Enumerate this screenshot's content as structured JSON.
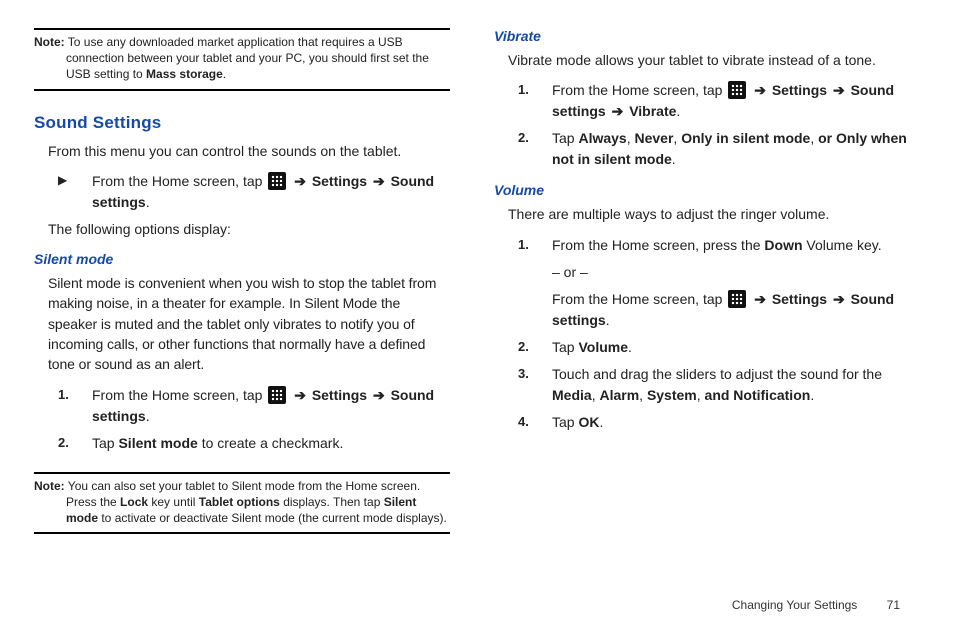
{
  "left": {
    "note1_label": "Note:",
    "note1_text": " To use any downloaded market application that requires a USB connection between your tablet and your PC, you should first set the USB setting to ",
    "note1_bold": "Mass storage",
    "note1_tail": ".",
    "h2": "Sound Settings",
    "intro": "From this menu you can control the sounds on the tablet.",
    "bullet_marker": "▶",
    "bullet_pre": "From the Home screen, tap ",
    "arrow": "➔",
    "settings": "Settings",
    "sound_settings": "Sound settings",
    "period": ".",
    "options": "The following options display:",
    "silent_h": "Silent mode",
    "silent_body": "Silent mode is convenient when you wish to stop the tablet from making noise, in a theater for example. In Silent Mode the speaker is muted and the tablet only vibrates to notify you of incoming calls, or other functions that normally have a defined tone or sound as an alert.",
    "s1_m": "1.",
    "s1_pre": "From the Home screen, tap ",
    "s2_m": "2.",
    "s2_pre": "Tap ",
    "s2_bold": "Silent mode",
    "s2_tail": " to create a checkmark.",
    "note2_label": "Note:",
    "note2_a": " You can also set your tablet to Silent mode from the Home screen. Press the ",
    "note2_lock": "Lock",
    "note2_b": " key until ",
    "note2_tabopt": "Tablet options",
    "note2_c": " displays. Then tap ",
    "note2_silent": "Silent mode",
    "note2_d": " to activate or deactivate Silent mode (the current mode displays)."
  },
  "right": {
    "vibrate_h": "Vibrate",
    "vibrate_body": "Vibrate mode allows your tablet to vibrate instead of a tone.",
    "v1_m": "1.",
    "v1_pre": "From the Home screen, tap ",
    "arrow": "➔",
    "settings": "Settings",
    "sound_settings": "Sound settings",
    "vibrate": "Vibrate",
    "period": ".",
    "v2_m": "2.",
    "v2_pre": "Tap ",
    "v2_always": "Always",
    "v2_c1": ", ",
    "v2_never": "Never",
    "v2_c2": ", ",
    "v2_onlysilent": "Only in silent mode",
    "v2_c3": ", ",
    "v2_oronly": "or Only when not in silent mode",
    "volume_h": "Volume",
    "volume_body": "There are multiple ways to adjust the ringer volume.",
    "u1_m": "1.",
    "u1_a": "From the Home screen, press the ",
    "u1_down": "Down",
    "u1_b": " Volume key.",
    "u1_or": "– or –",
    "u1_c": "From the Home screen, tap ",
    "u2_m": "2.",
    "u2_pre": "Tap ",
    "u2_vol": "Volume",
    "u3_m": "3.",
    "u3_a": "Touch and drag the sliders to adjust the sound for the ",
    "u3_media": "Media",
    "u3_c1": ", ",
    "u3_alarm": "Alarm",
    "u3_c2": ", ",
    "u3_system": "System",
    "u3_c3": ", ",
    "u3_andnotif": "and Notification",
    "u4_m": "4.",
    "u4_pre": " Tap ",
    "u4_ok": "OK"
  },
  "footer": {
    "section": "Changing Your Settings",
    "page": "71"
  }
}
